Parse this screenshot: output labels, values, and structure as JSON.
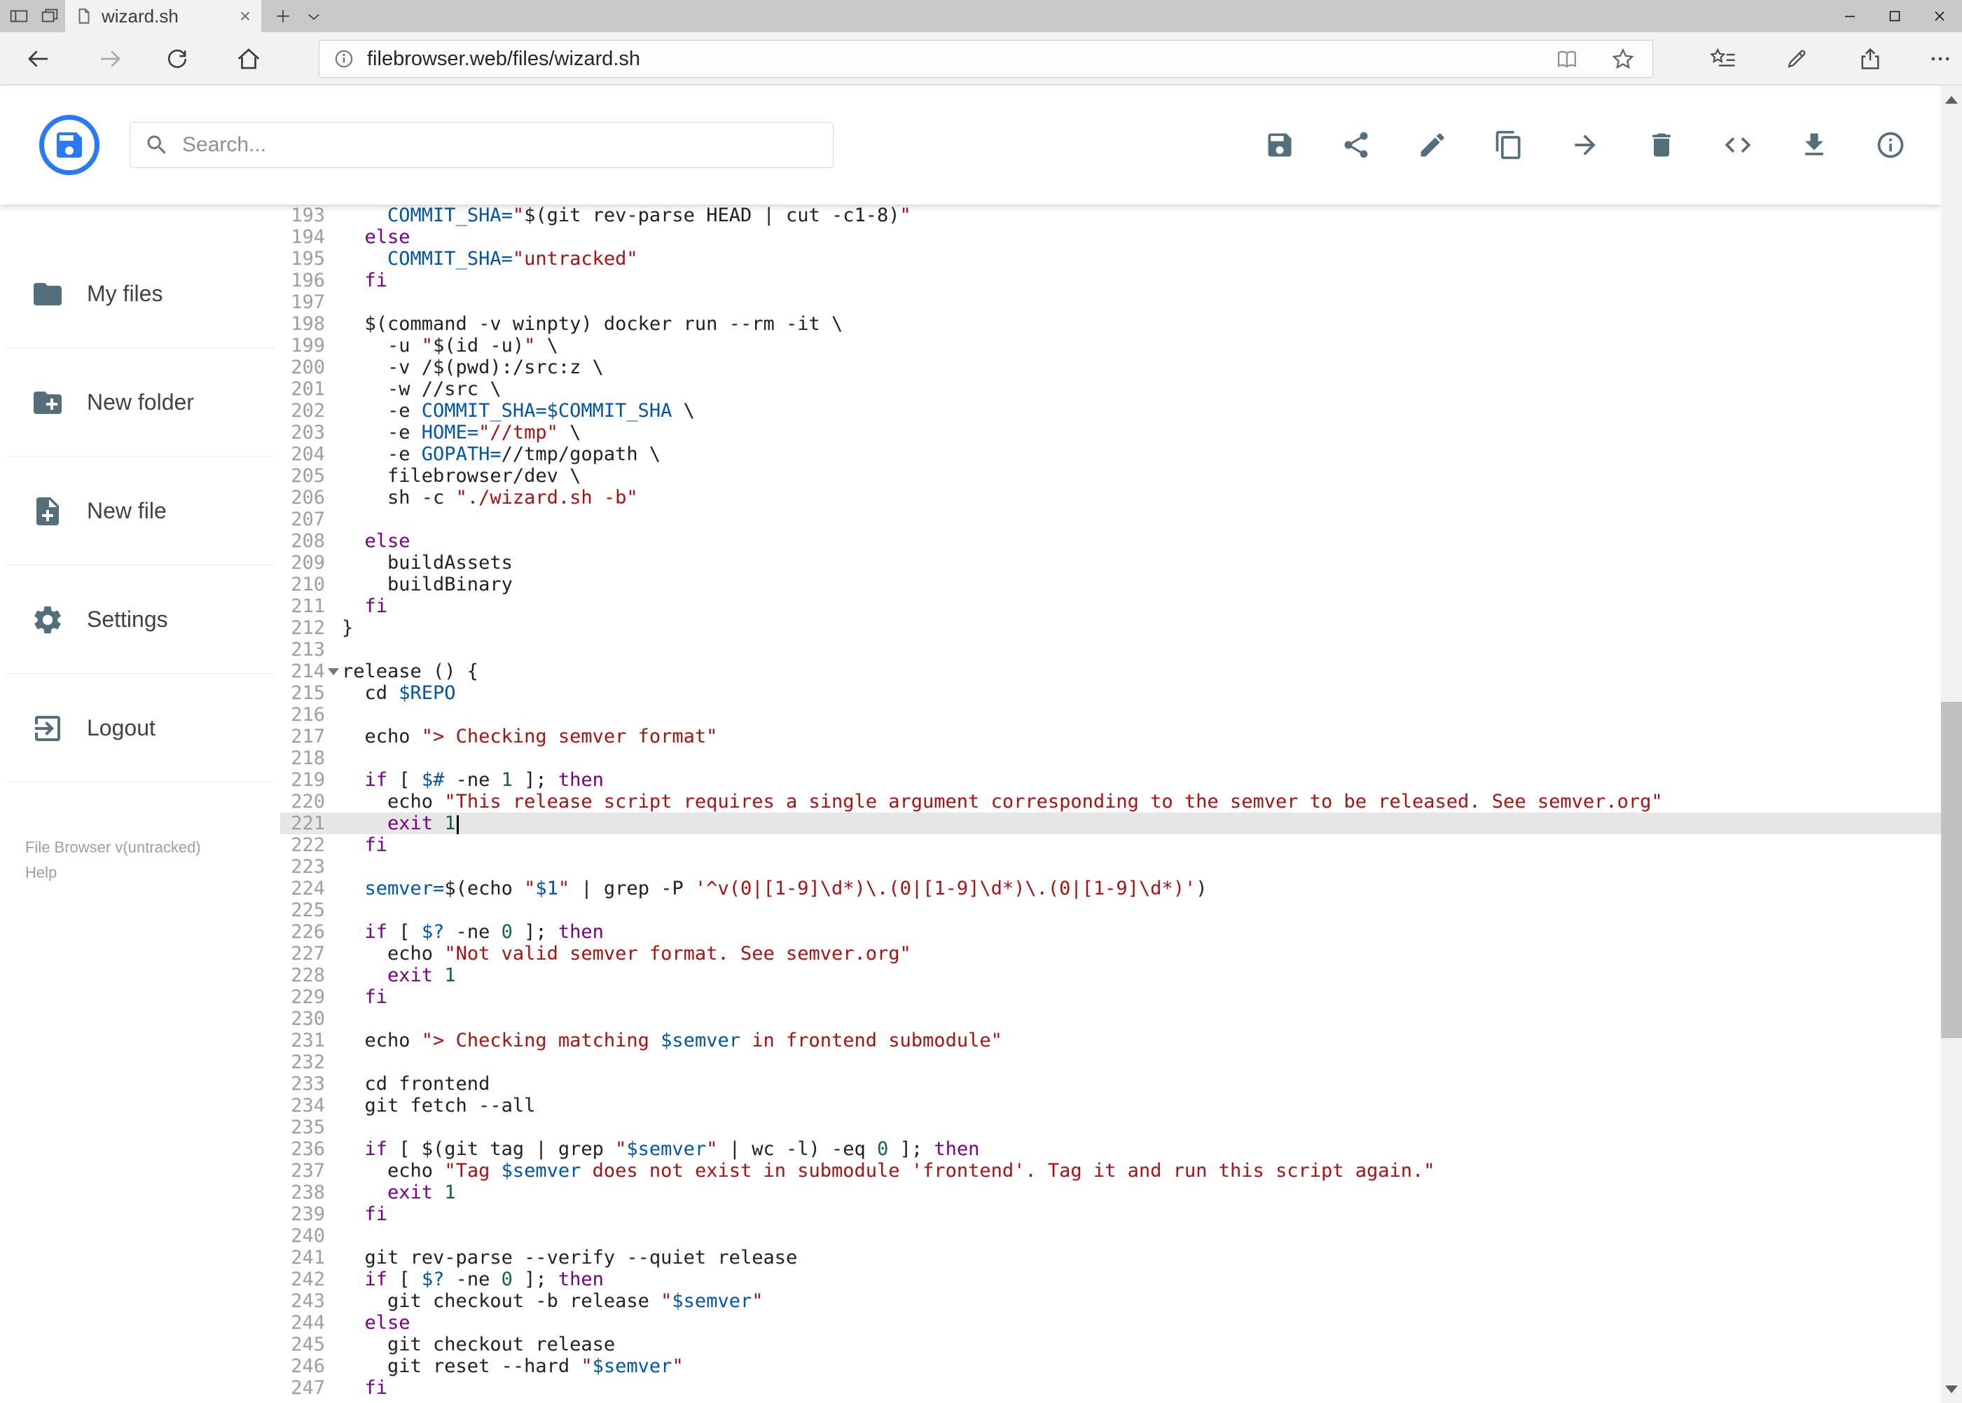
{
  "browser": {
    "tab_title": "wizard.sh",
    "url": "filebrowser.web/files/wizard.sh",
    "tabstrip_icons": [
      "set-tabs-aside",
      "tabs-preview",
      "page-favicon",
      "tab-close",
      "new-tab",
      "tab-preview-chevron"
    ],
    "nav_icons": [
      "back",
      "forward",
      "refresh",
      "home"
    ],
    "omnibox_icons": [
      "site-info",
      "reading-view",
      "favorite-star"
    ],
    "action_icons": [
      "hub",
      "annotate-pen",
      "share",
      "more"
    ],
    "window_controls": [
      "minimize",
      "maximize",
      "close"
    ]
  },
  "header": {
    "search_placeholder": "Search...",
    "actions": [
      {
        "name": "save",
        "icon": "save"
      },
      {
        "name": "share",
        "icon": "share"
      },
      {
        "name": "rename",
        "icon": "pencil"
      },
      {
        "name": "copy",
        "icon": "copy"
      },
      {
        "name": "move",
        "icon": "move"
      },
      {
        "name": "delete",
        "icon": "delete"
      },
      {
        "name": "raw-view",
        "icon": "code"
      },
      {
        "name": "download",
        "icon": "download"
      },
      {
        "name": "info",
        "icon": "info"
      }
    ]
  },
  "sidebar": {
    "items": [
      {
        "name": "my-files",
        "icon": "folder",
        "label": "My files"
      },
      {
        "name": "new-folder",
        "icon": "folder-plus",
        "label": "New folder"
      },
      {
        "name": "new-file",
        "icon": "file-plus",
        "label": "New file"
      },
      {
        "name": "settings",
        "icon": "gear",
        "label": "Settings"
      },
      {
        "name": "logout",
        "icon": "logout",
        "label": "Logout"
      }
    ],
    "footer": {
      "version": "File Browser v(untracked)",
      "help": "Help"
    }
  },
  "editor": {
    "active_line": 221,
    "cursor_line": 221,
    "fold_arrow_line": 214,
    "lines": [
      {
        "n": 193,
        "s": [
          [
            "d",
            "    "
          ],
          [
            "v",
            "COMMIT_SHA="
          ],
          [
            "s",
            "\""
          ],
          [
            "d",
            "$(git rev-parse HEAD | cut -c1-8)"
          ],
          [
            "s",
            "\""
          ]
        ]
      },
      {
        "n": 194,
        "s": [
          [
            "d",
            "  "
          ],
          [
            "k",
            "else"
          ]
        ]
      },
      {
        "n": 195,
        "s": [
          [
            "d",
            "    "
          ],
          [
            "v",
            "COMMIT_SHA="
          ],
          [
            "s",
            "\"untracked\""
          ]
        ]
      },
      {
        "n": 196,
        "s": [
          [
            "d",
            "  "
          ],
          [
            "k",
            "fi"
          ]
        ]
      },
      {
        "n": 197,
        "s": []
      },
      {
        "n": 198,
        "s": [
          [
            "d",
            "  $(command -v winpty) docker run --rm -it \\"
          ]
        ]
      },
      {
        "n": 199,
        "s": [
          [
            "d",
            "    -u "
          ],
          [
            "s",
            "\""
          ],
          [
            "d",
            "$(id -u)"
          ],
          [
            "s",
            "\""
          ],
          [
            "d",
            " \\"
          ]
        ]
      },
      {
        "n": 200,
        "s": [
          [
            "d",
            "    -v /$(pwd):/src:z \\"
          ]
        ]
      },
      {
        "n": 201,
        "s": [
          [
            "d",
            "    -w //src \\"
          ]
        ]
      },
      {
        "n": 202,
        "s": [
          [
            "d",
            "    -e "
          ],
          [
            "v",
            "COMMIT_SHA=$COMMIT_SHA"
          ],
          [
            "d",
            " \\"
          ]
        ]
      },
      {
        "n": 203,
        "s": [
          [
            "d",
            "    -e "
          ],
          [
            "v",
            "HOME="
          ],
          [
            "s",
            "\"//tmp\""
          ],
          [
            "d",
            " \\"
          ]
        ]
      },
      {
        "n": 204,
        "s": [
          [
            "d",
            "    -e "
          ],
          [
            "v",
            "GOPATH="
          ],
          [
            "d",
            "//tmp/gopath \\"
          ]
        ]
      },
      {
        "n": 205,
        "s": [
          [
            "d",
            "    filebrowser/dev \\"
          ]
        ]
      },
      {
        "n": 206,
        "s": [
          [
            "d",
            "    sh -c "
          ],
          [
            "s",
            "\"./wizard.sh -b\""
          ]
        ]
      },
      {
        "n": 207,
        "s": []
      },
      {
        "n": 208,
        "s": [
          [
            "d",
            "  "
          ],
          [
            "k",
            "else"
          ]
        ]
      },
      {
        "n": 209,
        "s": [
          [
            "d",
            "    buildAssets"
          ]
        ]
      },
      {
        "n": 210,
        "s": [
          [
            "d",
            "    buildBinary"
          ]
        ]
      },
      {
        "n": 211,
        "s": [
          [
            "d",
            "  "
          ],
          [
            "k",
            "fi"
          ]
        ]
      },
      {
        "n": 212,
        "s": [
          [
            "d",
            "}"
          ]
        ]
      },
      {
        "n": 213,
        "s": []
      },
      {
        "n": 214,
        "s": [
          [
            "d",
            "release () {"
          ]
        ]
      },
      {
        "n": 215,
        "s": [
          [
            "d",
            "  cd "
          ],
          [
            "v",
            "$REPO"
          ]
        ]
      },
      {
        "n": 216,
        "s": []
      },
      {
        "n": 217,
        "s": [
          [
            "d",
            "  echo "
          ],
          [
            "s",
            "\"> Checking semver format\""
          ]
        ]
      },
      {
        "n": 218,
        "s": []
      },
      {
        "n": 219,
        "s": [
          [
            "d",
            "  "
          ],
          [
            "k",
            "if"
          ],
          [
            "d",
            " [ "
          ],
          [
            "v",
            "$#"
          ],
          [
            "d",
            " -ne "
          ],
          [
            "n",
            "1"
          ],
          [
            "d",
            " ]; "
          ],
          [
            "k",
            "then"
          ]
        ]
      },
      {
        "n": 220,
        "s": [
          [
            "d",
            "    echo "
          ],
          [
            "s",
            "\"This release script requires a single argument corresponding to the semver to be released. See semver.org\""
          ]
        ]
      },
      {
        "n": 221,
        "s": [
          [
            "d",
            "    "
          ],
          [
            "k",
            "exit"
          ],
          [
            "d",
            " "
          ],
          [
            "n",
            "1"
          ]
        ]
      },
      {
        "n": 222,
        "s": [
          [
            "d",
            "  "
          ],
          [
            "k",
            "fi"
          ]
        ]
      },
      {
        "n": 223,
        "s": []
      },
      {
        "n": 224,
        "s": [
          [
            "d",
            "  "
          ],
          [
            "v",
            "semver="
          ],
          [
            "d",
            "$(echo "
          ],
          [
            "s",
            "\""
          ],
          [
            "v",
            "$1"
          ],
          [
            "s",
            "\""
          ],
          [
            "d",
            " | grep -P "
          ],
          [
            "s",
            "'^v(0|[1-9]\\d*)\\.(0|[1-9]\\d*)\\.(0|[1-9]\\d*)'"
          ],
          [
            "d",
            ")"
          ]
        ]
      },
      {
        "n": 225,
        "s": []
      },
      {
        "n": 226,
        "s": [
          [
            "d",
            "  "
          ],
          [
            "k",
            "if"
          ],
          [
            "d",
            " [ "
          ],
          [
            "v",
            "$?"
          ],
          [
            "d",
            " -ne "
          ],
          [
            "n",
            "0"
          ],
          [
            "d",
            " ]; "
          ],
          [
            "k",
            "then"
          ]
        ]
      },
      {
        "n": 227,
        "s": [
          [
            "d",
            "    echo "
          ],
          [
            "s",
            "\"Not valid semver format. See semver.org\""
          ]
        ]
      },
      {
        "n": 228,
        "s": [
          [
            "d",
            "    "
          ],
          [
            "k",
            "exit"
          ],
          [
            "d",
            " "
          ],
          [
            "n",
            "1"
          ]
        ]
      },
      {
        "n": 229,
        "s": [
          [
            "d",
            "  "
          ],
          [
            "k",
            "fi"
          ]
        ]
      },
      {
        "n": 230,
        "s": []
      },
      {
        "n": 231,
        "s": [
          [
            "d",
            "  echo "
          ],
          [
            "s",
            "\"> Checking matching "
          ],
          [
            "v",
            "$semver"
          ],
          [
            "s",
            " in frontend submodule\""
          ]
        ]
      },
      {
        "n": 232,
        "s": []
      },
      {
        "n": 233,
        "s": [
          [
            "d",
            "  cd frontend"
          ]
        ]
      },
      {
        "n": 234,
        "s": [
          [
            "d",
            "  git fetch --all"
          ]
        ]
      },
      {
        "n": 235,
        "s": []
      },
      {
        "n": 236,
        "s": [
          [
            "d",
            "  "
          ],
          [
            "k",
            "if"
          ],
          [
            "d",
            " [ $(git tag | grep "
          ],
          [
            "s",
            "\""
          ],
          [
            "v",
            "$semver"
          ],
          [
            "s",
            "\""
          ],
          [
            "d",
            " | wc -l) -eq "
          ],
          [
            "n",
            "0"
          ],
          [
            "d",
            " ]; "
          ],
          [
            "k",
            "then"
          ]
        ]
      },
      {
        "n": 237,
        "s": [
          [
            "d",
            "    echo "
          ],
          [
            "s",
            "\"Tag "
          ],
          [
            "v",
            "$semver"
          ],
          [
            "s",
            " does not exist in submodule 'frontend'. Tag it and run this script again.\""
          ]
        ]
      },
      {
        "n": 238,
        "s": [
          [
            "d",
            "    "
          ],
          [
            "k",
            "exit"
          ],
          [
            "d",
            " "
          ],
          [
            "n",
            "1"
          ]
        ]
      },
      {
        "n": 239,
        "s": [
          [
            "d",
            "  "
          ],
          [
            "k",
            "fi"
          ]
        ]
      },
      {
        "n": 240,
        "s": []
      },
      {
        "n": 241,
        "s": [
          [
            "d",
            "  git rev-parse --verify --quiet release"
          ]
        ]
      },
      {
        "n": 242,
        "s": [
          [
            "d",
            "  "
          ],
          [
            "k",
            "if"
          ],
          [
            "d",
            " [ "
          ],
          [
            "v",
            "$?"
          ],
          [
            "d",
            " -ne "
          ],
          [
            "n",
            "0"
          ],
          [
            "d",
            " ]; "
          ],
          [
            "k",
            "then"
          ]
        ]
      },
      {
        "n": 243,
        "s": [
          [
            "d",
            "    git checkout -b release "
          ],
          [
            "s",
            "\""
          ],
          [
            "v",
            "$semver"
          ],
          [
            "s",
            "\""
          ]
        ]
      },
      {
        "n": 244,
        "s": [
          [
            "d",
            "  "
          ],
          [
            "k",
            "else"
          ]
        ]
      },
      {
        "n": 245,
        "s": [
          [
            "d",
            "    git checkout release"
          ]
        ]
      },
      {
        "n": 246,
        "s": [
          [
            "d",
            "    git reset --hard "
          ],
          [
            "s",
            "\""
          ],
          [
            "v",
            "$semver"
          ],
          [
            "s",
            "\""
          ]
        ]
      },
      {
        "n": 247,
        "s": [
          [
            "d",
            "  "
          ],
          [
            "k",
            "fi"
          ]
        ]
      }
    ]
  },
  "colors": {
    "accent": "#2979ff",
    "icon": "#546e7a",
    "active_line_bg": "#e7e7e7",
    "keyword": "#770088",
    "variable": "#0055aa",
    "string": "#aa1111",
    "number": "#116644",
    "code_default": "#212121",
    "line_number": "#9e9e9e"
  }
}
